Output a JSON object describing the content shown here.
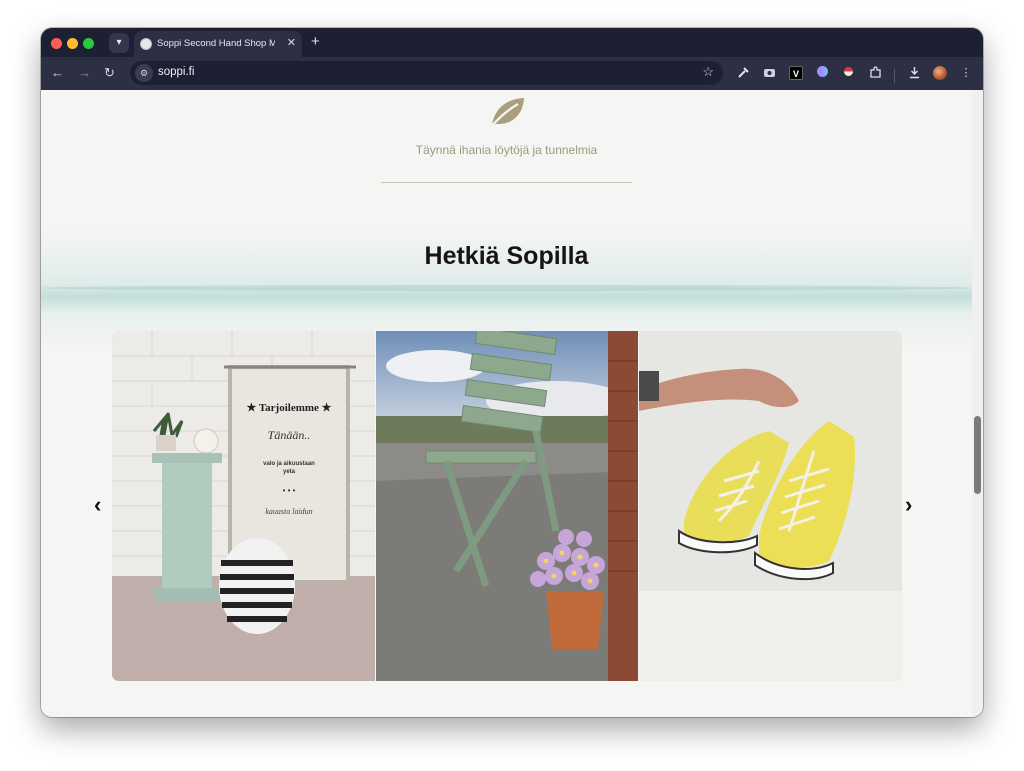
{
  "browser": {
    "tab_title": "Soppi Second Hand Shop My",
    "tab_close": "✕",
    "new_tab": "+",
    "url": "soppi.fi",
    "nav": {
      "back": "←",
      "forward": "→",
      "reload": "↻"
    },
    "extensions": {
      "v_label": "V"
    }
  },
  "page": {
    "tagline": "Täynnä ihania löytöjä ja tunnelmia",
    "heading": "Hetkiä Sopilla",
    "carousel": {
      "prev": "‹",
      "next": "›",
      "slides": [
        {
          "sign_lines": [
            "★ Tarjoilemme ★",
            "Tänään..",
            "valo ja aikuustaan",
            "yeta",
            "• • •",
            "kauasta laidun"
          ]
        },
        {},
        {}
      ]
    }
  },
  "colors": {
    "titlebar": "#1d1f33",
    "toolbar": "#2d2f45",
    "page_bg": "#f5f5f3",
    "leaf": "#a89f7d",
    "tagline": "#9a9b7c"
  }
}
